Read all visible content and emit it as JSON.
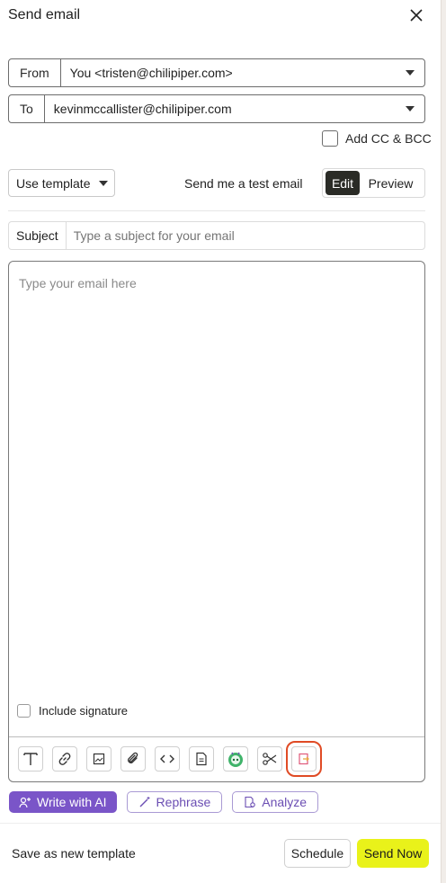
{
  "header": {
    "title": "Send email"
  },
  "from": {
    "label": "From",
    "value": "You <tristen@chilipiper.com>"
  },
  "to": {
    "label": "To",
    "value": "kevinmccallister@chilipiper.com"
  },
  "cc_bcc": {
    "label": "Add CC & BCC",
    "checked": false
  },
  "template": {
    "label": "Use template"
  },
  "test_email": {
    "label": "Send me a test email"
  },
  "mode": {
    "edit": "Edit",
    "preview": "Preview",
    "active": "Edit"
  },
  "subject": {
    "label": "Subject",
    "placeholder": "Type a subject for your email",
    "value": ""
  },
  "body": {
    "placeholder": "Type your email here",
    "value": ""
  },
  "signature": {
    "label": "Include signature",
    "checked": false
  },
  "toolbar": {
    "tools": [
      "text-format-icon",
      "link-icon",
      "image-icon",
      "attachment-icon",
      "code-icon",
      "document-icon",
      "bot-icon",
      "scissors-icon",
      "insert-file-icon"
    ],
    "highlighted": "insert-file-icon"
  },
  "ai": {
    "write": "Write with AI",
    "rephrase": "Rephrase",
    "analyze": "Analyze"
  },
  "footer": {
    "save_template": "Save as new template",
    "schedule": "Schedule",
    "send_now": "Send Now"
  },
  "colors": {
    "accent_purple": "#7a55c8",
    "send_yellow": "#e9f21a",
    "highlight_red": "#e04b25",
    "edit_active": "#2a2b26"
  }
}
